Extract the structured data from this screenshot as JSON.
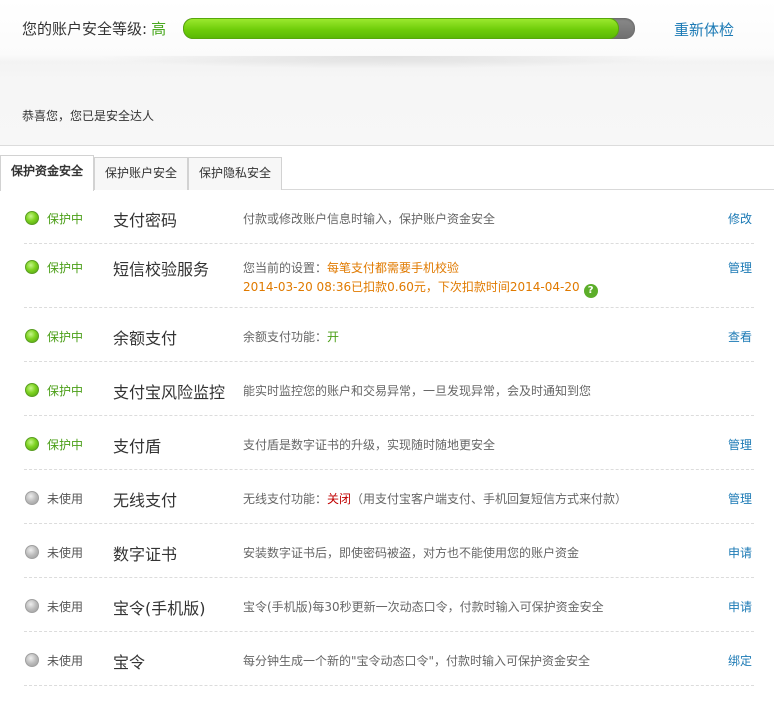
{
  "header": {
    "level_label": "您的账户安全等级:",
    "level_value": "高",
    "progress": 0.965,
    "recheck_label": "重新体检",
    "congrats": "恭喜您，您已是安全达人"
  },
  "tabs": [
    {
      "label": "保护资金安全",
      "active": true
    },
    {
      "label": "保护账户安全",
      "active": false
    },
    {
      "label": "保护隐私安全",
      "active": false
    }
  ],
  "colors": {
    "accent_link": "#1c7ab5",
    "status_on": "#4a9e16",
    "warning": "#e07a00",
    "closed": "#c00000"
  },
  "rows": [
    {
      "status": "保护中",
      "name": "支付密码",
      "desc": "付款或修改账户信息时输入，保护账户资金安全",
      "action": "修改"
    },
    {
      "status": "保护中",
      "name": "短信校验服务",
      "desc_prefix": "您当前的设置：",
      "desc_highlight": "每笔支付都需要手机校验",
      "desc_line2": "2014-03-20 08:36已扣款0.60元，下次扣款时间2014-04-20",
      "help_icon": "?",
      "action": "管理"
    },
    {
      "status": "保护中",
      "name": "余额支付",
      "desc_prefix": "余额支付功能：",
      "desc_highlight": "开",
      "action": "查看"
    },
    {
      "status": "保护中",
      "name": "支付宝风险监控",
      "desc": "能实时监控您的账户和交易异常，一旦发现异常，会及时通知到您",
      "action": ""
    },
    {
      "status": "保护中",
      "name": "支付盾",
      "desc": "支付盾是数字证书的升级，实现随时随地更安全",
      "action": "管理"
    },
    {
      "status": "未使用",
      "name": "无线支付",
      "desc_prefix": "无线支付功能：",
      "desc_highlight": "关闭",
      "desc_suffix": "（用支付宝客户端支付、手机回复短信方式来付款）",
      "action": "管理"
    },
    {
      "status": "未使用",
      "name": "数字证书",
      "desc": "安装数字证书后，即使密码被盗，对方也不能使用您的账户资金",
      "action": "申请"
    },
    {
      "status": "未使用",
      "name": "宝令(手机版)",
      "desc": "宝令(手机版)每30秒更新一次动态口令，付款时输入可保护资金安全",
      "action": "申请"
    },
    {
      "status": "未使用",
      "name": "宝令",
      "desc": "每分钟生成一个新的\"宝令动态口令\"，付款时输入可保护资金安全",
      "action": "绑定"
    }
  ]
}
